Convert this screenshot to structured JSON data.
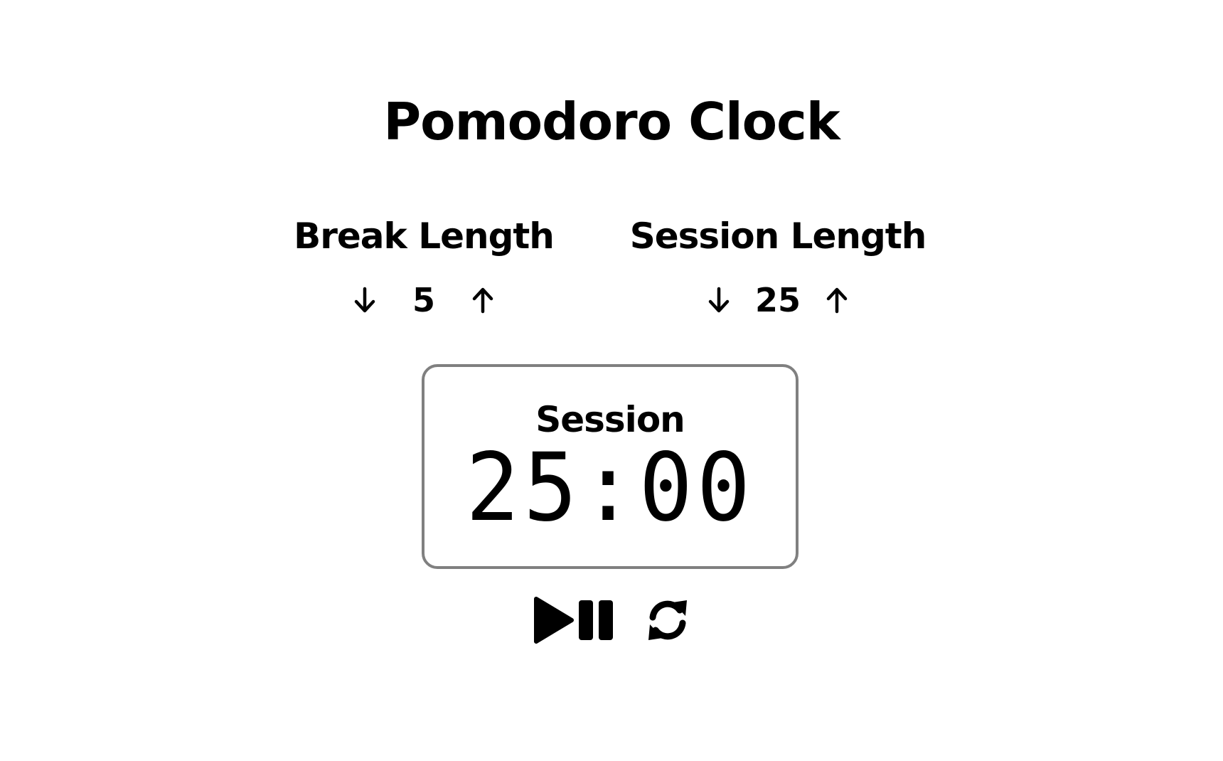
{
  "app": {
    "title": "Pomodoro Clock"
  },
  "break": {
    "label": "Break Length",
    "value": "5",
    "decrement_icon": "arrow-down-icon",
    "increment_icon": "arrow-up-icon"
  },
  "session": {
    "label": "Session Length",
    "value": "25",
    "decrement_icon": "arrow-down-icon",
    "increment_icon": "arrow-up-icon"
  },
  "timer": {
    "label": "Session",
    "time_left": "25:00",
    "border_color": "#808080"
  },
  "controls": {
    "start_stop_icon": "play-pause-icon",
    "reset_icon": "refresh-icon"
  }
}
